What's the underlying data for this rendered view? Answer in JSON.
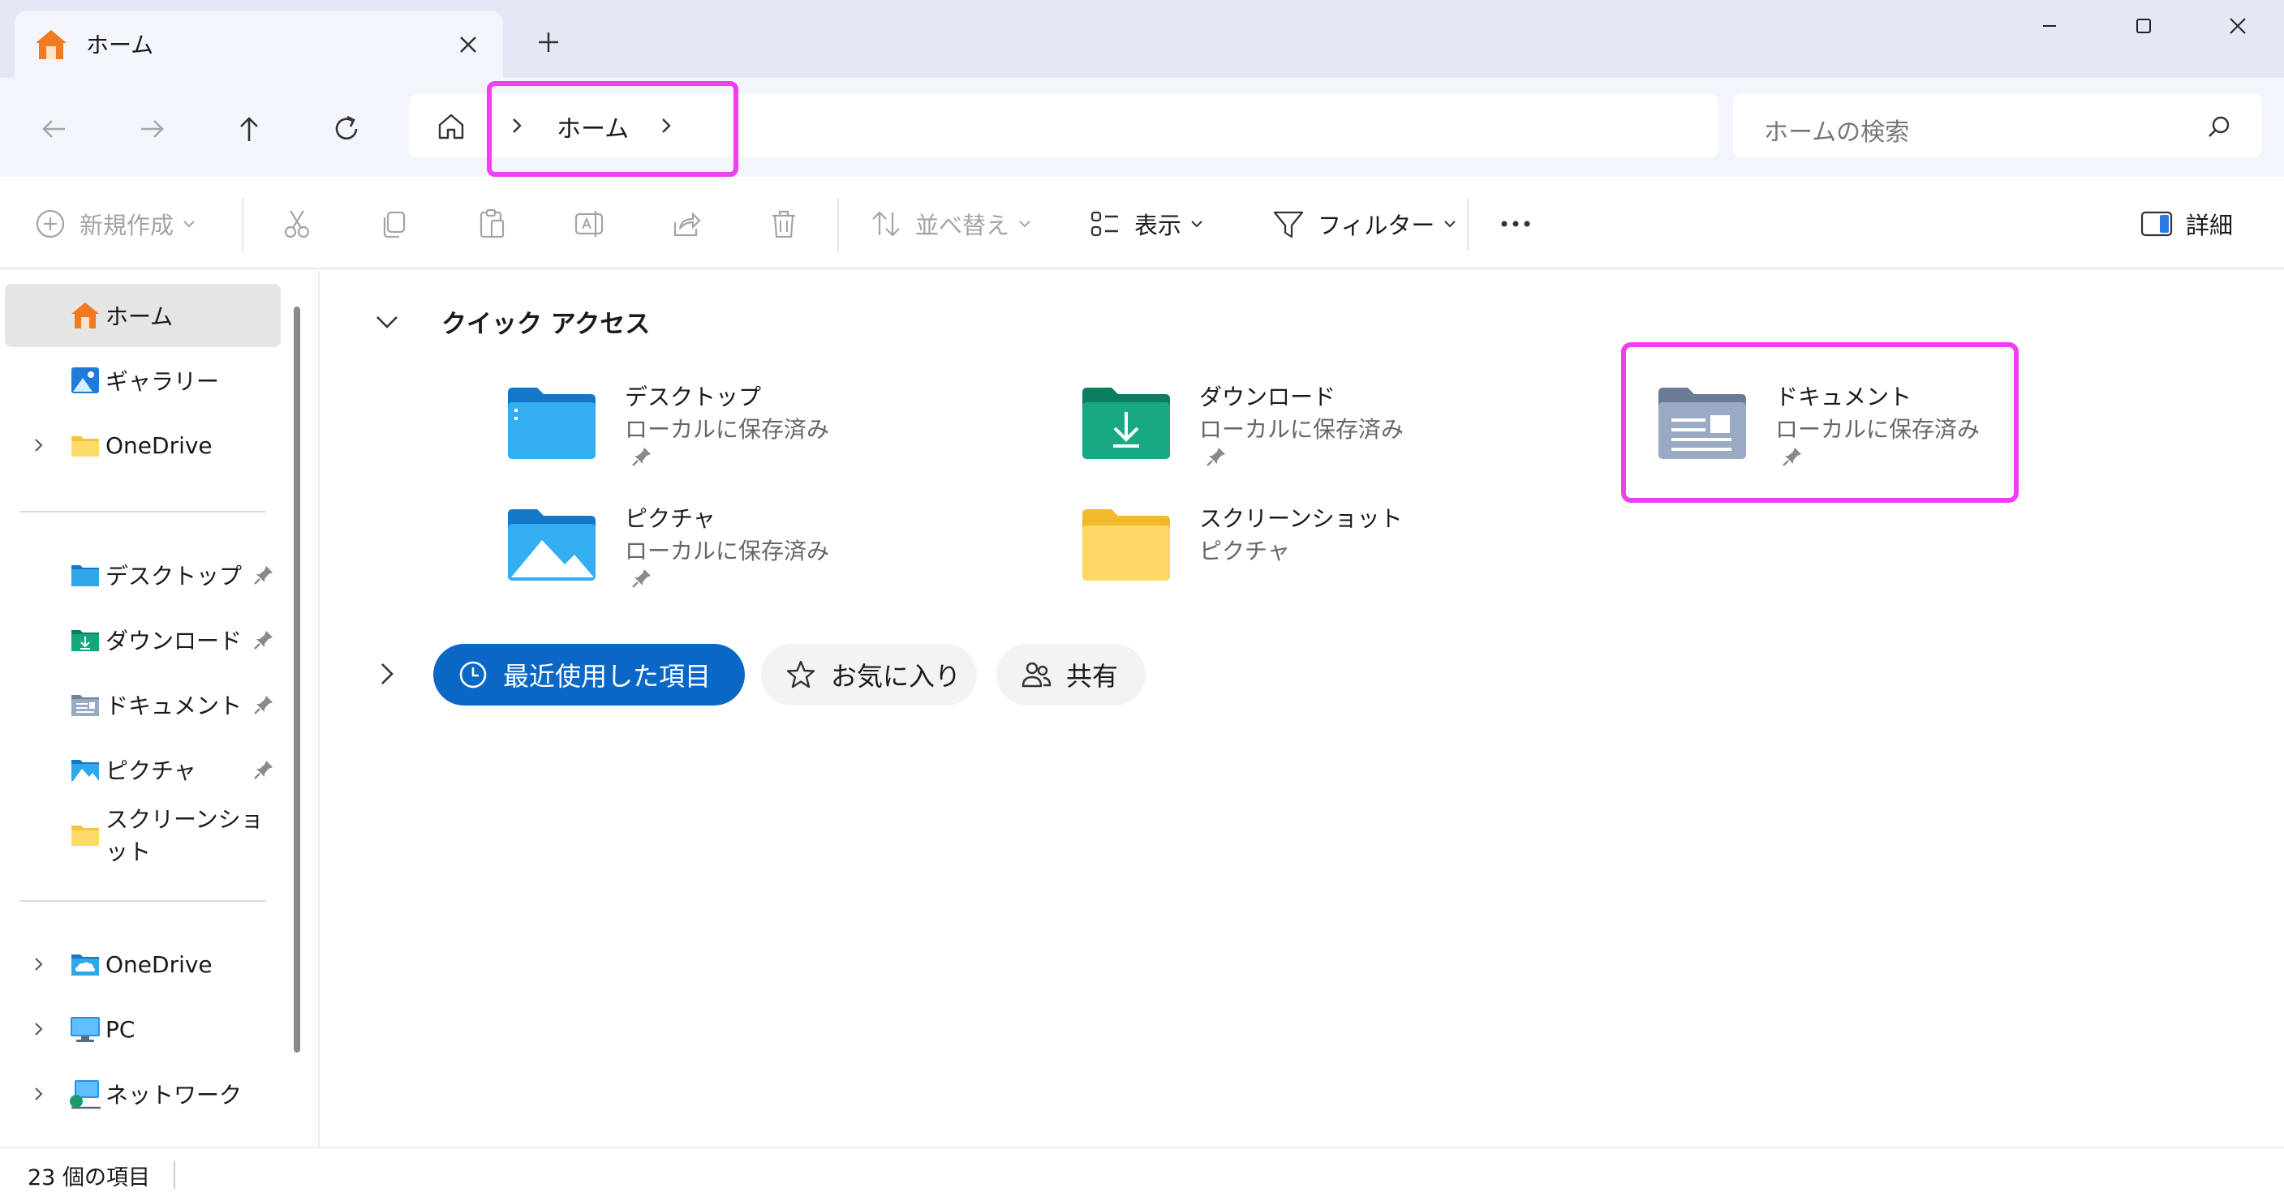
{
  "window": {
    "tab_title": "ホーム",
    "minimize_icon": "minimize-icon",
    "maximize_icon": "maximize-icon",
    "close_icon": "close-icon"
  },
  "address": {
    "breadcrumb": "ホーム",
    "search_placeholder": "ホームの検索"
  },
  "toolbar": {
    "new_label": "新規作成",
    "sort_label": "並べ替え",
    "view_label": "表示",
    "filter_label": "フィルター",
    "details_label": "詳細"
  },
  "sidebar": {
    "top": [
      {
        "label": "ホーム",
        "icon": "home-icon",
        "active": true
      },
      {
        "label": "ギャラリー",
        "icon": "gallery-icon"
      },
      {
        "label": "OneDrive",
        "icon": "folder-icon",
        "expandable": true
      }
    ],
    "pinned": [
      {
        "label": "デスクトップ",
        "icon": "desktop-folder-icon",
        "pinned": true
      },
      {
        "label": "ダウンロード",
        "icon": "download-folder-icon",
        "pinned": true
      },
      {
        "label": "ドキュメント",
        "icon": "documents-folder-icon",
        "pinned": true
      },
      {
        "label": "ピクチャ",
        "icon": "pictures-folder-icon",
        "pinned": true
      },
      {
        "label": "スクリーンショット",
        "icon": "folder-icon",
        "pinned": false
      }
    ],
    "bottom": [
      {
        "label": "OneDrive",
        "icon": "cloud-icon"
      },
      {
        "label": "PC",
        "icon": "pc-icon"
      },
      {
        "label": "ネットワーク",
        "icon": "network-icon"
      }
    ]
  },
  "quick_access": {
    "title": "クイック アクセス",
    "items": [
      {
        "name": "デスクトップ",
        "sub": "ローカルに保存済み",
        "pinned": true,
        "icon": "desktop-folder-icon"
      },
      {
        "name": "ダウンロード",
        "sub": "ローカルに保存済み",
        "pinned": true,
        "icon": "download-folder-icon"
      },
      {
        "name": "ドキュメント",
        "sub": "ローカルに保存済み",
        "pinned": true,
        "icon": "documents-folder-icon"
      },
      {
        "name": "ピクチャ",
        "sub": "ローカルに保存済み",
        "pinned": true,
        "icon": "pictures-folder-icon"
      },
      {
        "name": "スクリーンショット",
        "sub": "ピクチャ",
        "pinned": false,
        "icon": "folder-icon"
      }
    ]
  },
  "filters": {
    "recent": "最近使用した項目",
    "favorites": "お気に入り",
    "shared": "共有"
  },
  "status": {
    "item_count": "23 個の項目"
  },
  "colors": {
    "accent": "#0a67c6",
    "highlight": "#ee3ff0",
    "titlebar": "#e3e8f4",
    "navrow": "#f2f5fb"
  }
}
